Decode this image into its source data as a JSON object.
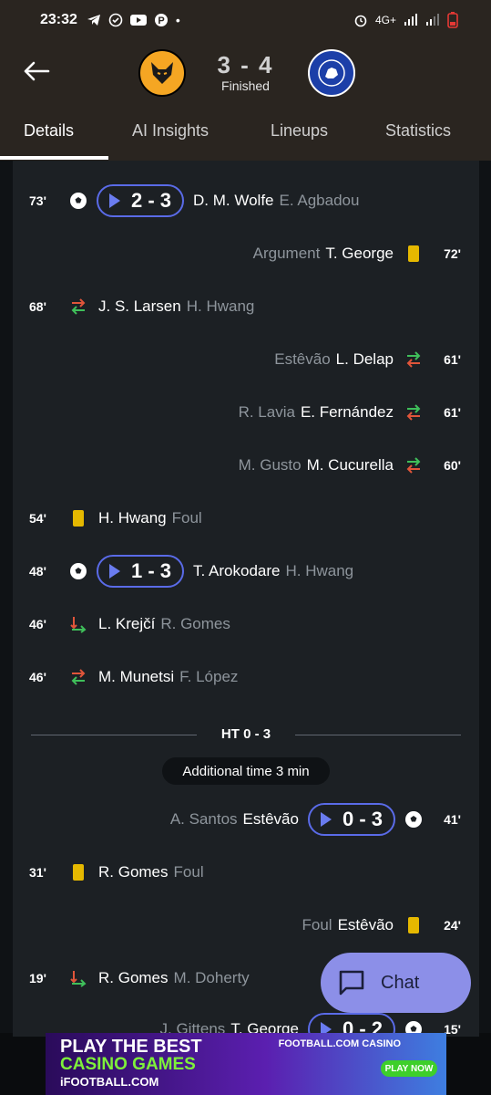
{
  "status": {
    "time": "23:32",
    "network": "4G+"
  },
  "header": {
    "score": "3 - 4",
    "status_text": "Finished",
    "home_team_icon": "wolves-logo",
    "away_team_icon": "chelsea-logo"
  },
  "tabs": [
    "Details",
    "AI Insights",
    "Lineups",
    "Statistics"
  ],
  "events": [
    {
      "minute": "73'",
      "side": "home",
      "type": "goal",
      "score": "2 - 3",
      "player": "D. M. Wolfe",
      "secondary": "E. Agbadou"
    },
    {
      "minute": "72'",
      "side": "away",
      "type": "yellow-card",
      "player": "T. George",
      "secondary": "Argument"
    },
    {
      "minute": "68'",
      "side": "home",
      "type": "substitution",
      "player": "J. S. Larsen",
      "secondary": "H. Hwang"
    },
    {
      "minute": "61'",
      "side": "away",
      "type": "substitution",
      "player": "L. Delap",
      "secondary": "Estêvão"
    },
    {
      "minute": "61'",
      "side": "away",
      "type": "substitution",
      "player": "E. Fernández",
      "secondary": "R. Lavia"
    },
    {
      "minute": "60'",
      "side": "away",
      "type": "substitution",
      "player": "M. Cucurella",
      "secondary": "M. Gusto"
    },
    {
      "minute": "54'",
      "side": "home",
      "type": "yellow-card",
      "player": "H. Hwang",
      "secondary": "Foul"
    },
    {
      "minute": "48'",
      "side": "home",
      "type": "goal",
      "score": "1 - 3",
      "player": "T. Arokodare",
      "secondary": "H. Hwang"
    },
    {
      "minute": "46'",
      "side": "home",
      "type": "substitution",
      "player": "L. Krejčí",
      "secondary": "R. Gomes"
    },
    {
      "minute": "46'",
      "side": "home",
      "type": "substitution",
      "player": "M. Munetsi",
      "secondary": "F. López"
    },
    {
      "minute": "41'",
      "side": "away",
      "type": "goal",
      "score": "0 - 3",
      "player": "Estêvão",
      "secondary": "A. Santos"
    },
    {
      "minute": "31'",
      "side": "home",
      "type": "yellow-card",
      "player": "R. Gomes",
      "secondary": "Foul"
    },
    {
      "minute": "24'",
      "side": "away",
      "type": "yellow-card",
      "player": "Estêvão",
      "secondary": "Foul"
    },
    {
      "minute": "19'",
      "side": "home",
      "type": "substitution",
      "player": "R. Gomes",
      "secondary": "M. Doherty"
    },
    {
      "minute": "15'",
      "side": "away",
      "type": "goal",
      "score": "0 - 2",
      "player": "T. George",
      "secondary": "J. Gittens"
    }
  ],
  "halftime": "HT 0 - 3",
  "additional_time": "Additional time 3 min",
  "chat": {
    "label": "Chat"
  },
  "ad": {
    "line1": "PLAY THE BEST",
    "line2": "CASINO GAMES",
    "line3": "iFOOTBALL.COM",
    "brand": "FOOTBALL.COM CASINO",
    "cta": "PLAY NOW"
  },
  "colors": {
    "accent": "#5a6be8",
    "sub_in": "#3fbf5a",
    "sub_out": "#e0553a",
    "yellow_card": "#e5b800"
  }
}
